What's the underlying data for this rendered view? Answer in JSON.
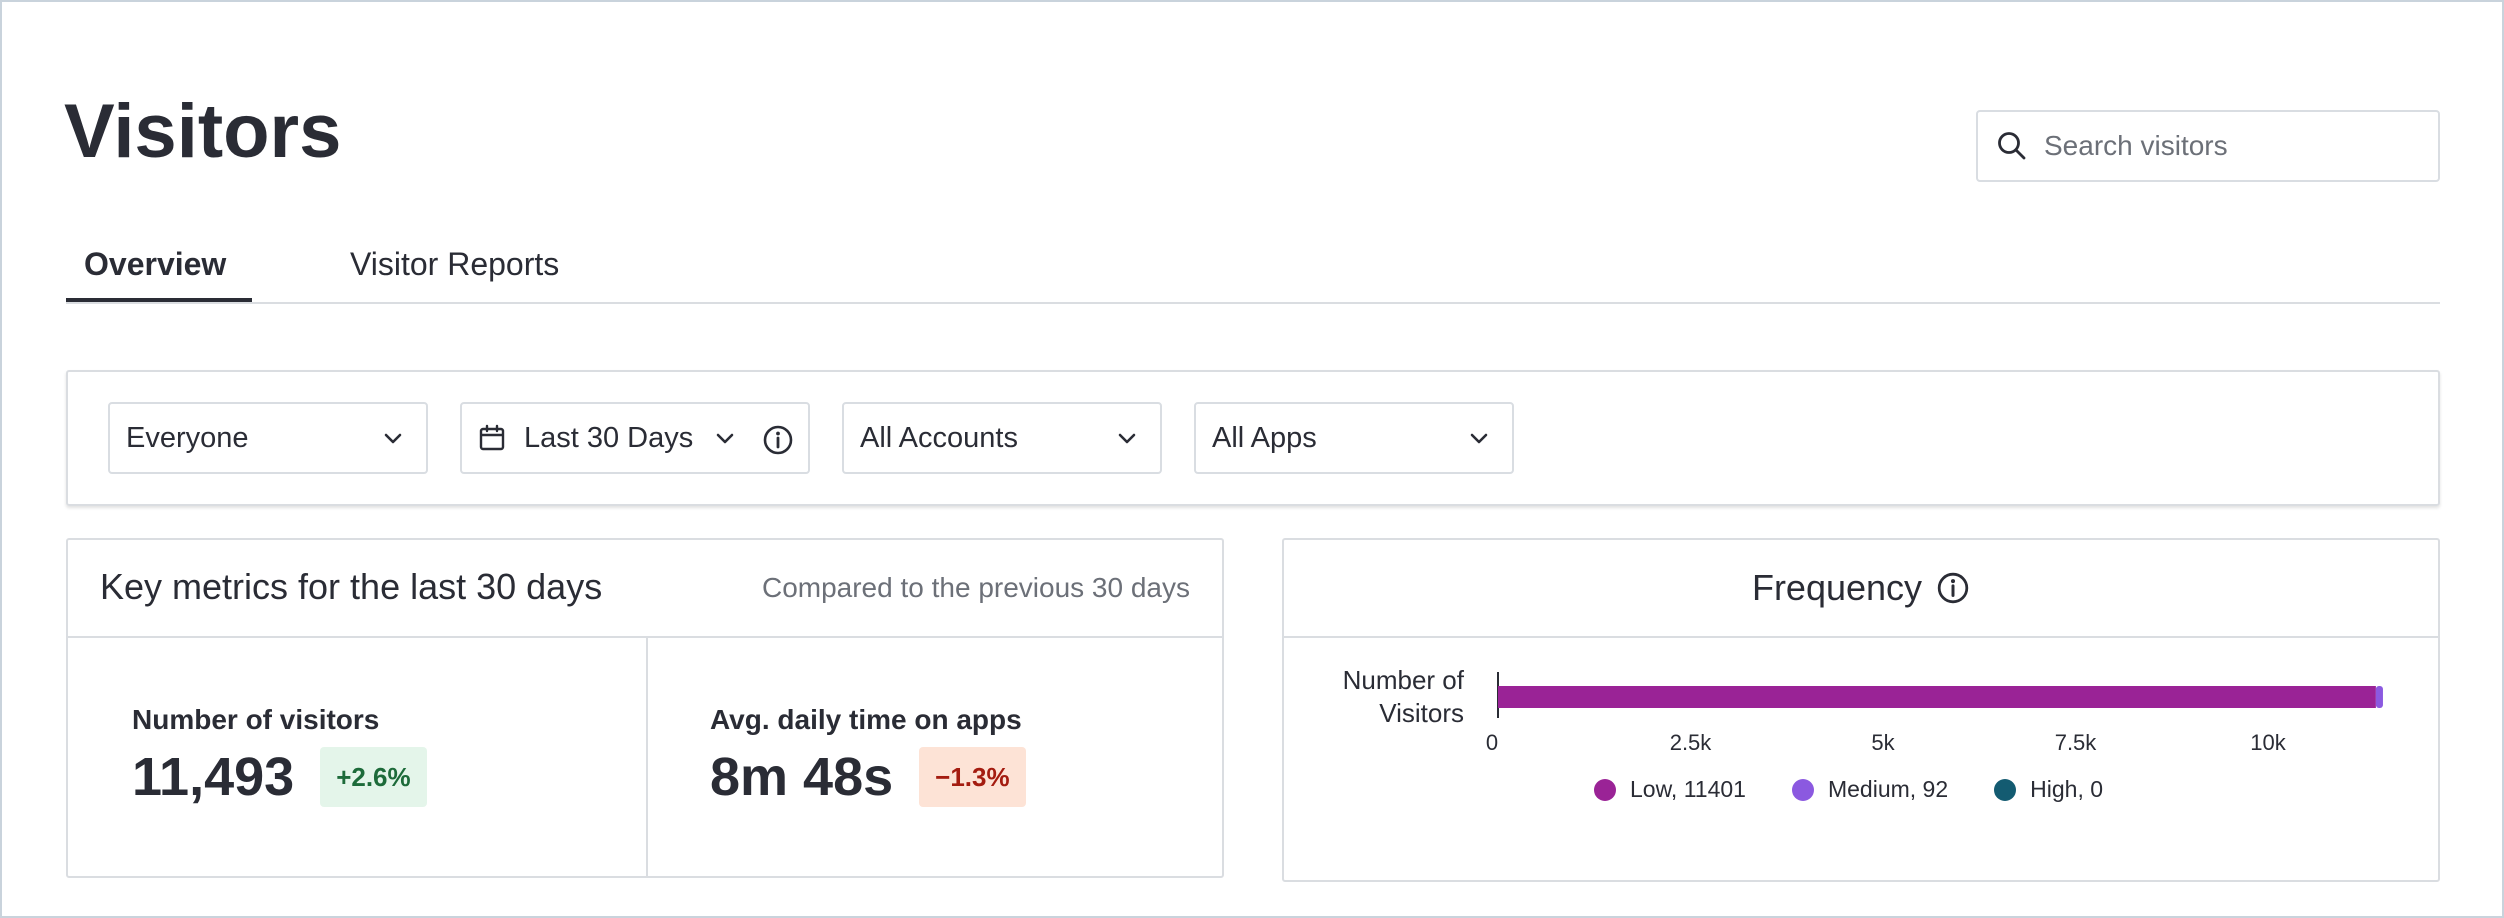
{
  "page": {
    "title": "Visitors"
  },
  "search": {
    "placeholder": "Search visitors"
  },
  "tabs": [
    {
      "label": "Overview",
      "active": true
    },
    {
      "label": "Visitor Reports",
      "active": false
    }
  ],
  "filters": {
    "segment": "Everyone",
    "date_range": "Last 30 Days",
    "accounts": "All Accounts",
    "apps": "All Apps"
  },
  "key_metrics": {
    "title": "Key metrics for the last 30 days",
    "subtitle": "Compared to the previous 30 days",
    "metrics": [
      {
        "label": "Number of visitors",
        "value": "11,493",
        "change": "+2.6%",
        "trend": "up"
      },
      {
        "label": "Avg. daily time on apps",
        "value": "8m 48s",
        "change": "−1.3%",
        "trend": "down"
      }
    ]
  },
  "colors": {
    "up_bg": "#e4f5ea",
    "up_fg": "#1d6b3a",
    "down_bg": "#fde3d6",
    "down_fg": "#a41c10",
    "low": "#9a2396",
    "medium": "#8b59e0",
    "high": "#135b71"
  },
  "icons": {
    "search": "search-icon",
    "calendar": "calendar-icon",
    "chevron": "chevron-down-icon",
    "info": "info-icon"
  },
  "frequency": {
    "title": "Frequency",
    "chart_data": {
      "type": "bar",
      "orientation": "horizontal",
      "stacked": true,
      "categories": [
        "Number of Visitors"
      ],
      "series": [
        {
          "name": "Low",
          "values": [
            11401
          ],
          "legend": "Low, 11401"
        },
        {
          "name": "Medium",
          "values": [
            92
          ],
          "legend": "Medium, 92"
        },
        {
          "name": "High",
          "values": [
            0
          ],
          "legend": "High, 0"
        }
      ],
      "ylabel_lines": [
        "Number of",
        "Visitors"
      ],
      "xlim": [
        0,
        11493
      ],
      "xticks": [
        {
          "value": 0,
          "label": "0"
        },
        {
          "value": 2500,
          "label": "2.5k"
        },
        {
          "value": 5000,
          "label": "5k"
        },
        {
          "value": 7500,
          "label": "7.5k"
        },
        {
          "value": 10000,
          "label": "10k"
        }
      ],
      "legend_position": "bottom",
      "grid": false
    }
  }
}
